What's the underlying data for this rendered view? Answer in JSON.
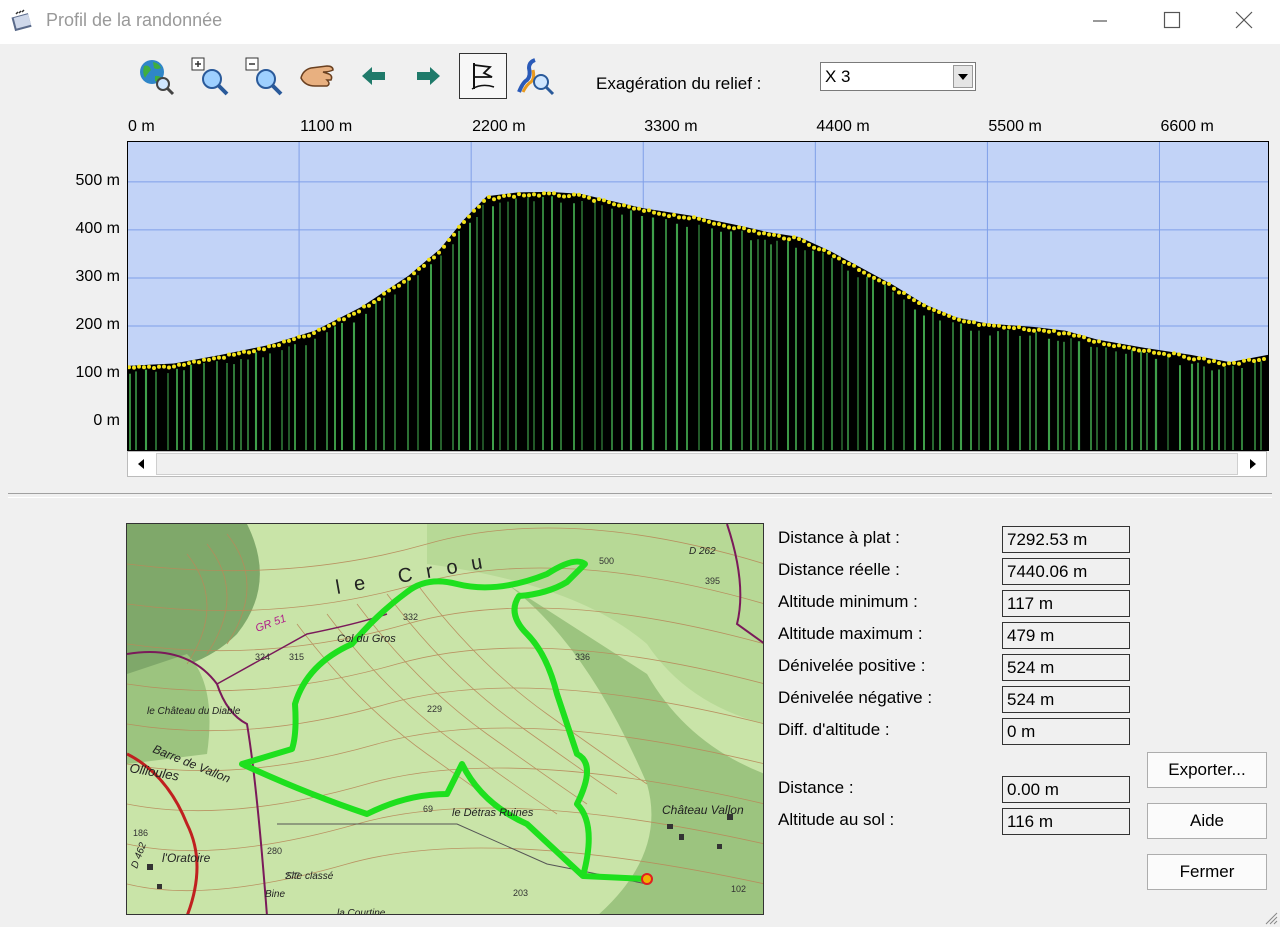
{
  "window": {
    "title": "Profil de la randonnée"
  },
  "toolbar": {
    "buttons": [
      {
        "name": "globe-search-icon"
      },
      {
        "name": "zoom-in-icon"
      },
      {
        "name": "zoom-out-icon"
      },
      {
        "name": "hand-pan-icon"
      },
      {
        "name": "arrow-left-icon"
      },
      {
        "name": "arrow-right-icon"
      },
      {
        "name": "flag-icon",
        "active": true
      },
      {
        "name": "route-search-icon"
      }
    ],
    "exaggeration_label": "Exagération du relief :",
    "exaggeration_value": "X 3"
  },
  "chart_data": {
    "type": "area",
    "x_ticks": [
      "0 m",
      "1100 m",
      "2200 m",
      "3300 m",
      "4400 m",
      "5500 m",
      "6600 m"
    ],
    "y_ticks": [
      "500 m",
      "400 m",
      "300 m",
      "200 m",
      "100 m",
      "0 m"
    ],
    "xlim": [
      0,
      7300
    ],
    "ylim": [
      -60,
      585
    ],
    "grid": true,
    "colors": {
      "sky": "#c2d3f7",
      "grid": "#7f9fe8",
      "terrain": "#000000",
      "stripes": "#3fa04a",
      "markers": "#f2e21a"
    },
    "points": [
      {
        "x": 0,
        "y": 117
      },
      {
        "x": 300,
        "y": 122
      },
      {
        "x": 600,
        "y": 140
      },
      {
        "x": 900,
        "y": 160
      },
      {
        "x": 1200,
        "y": 190
      },
      {
        "x": 1500,
        "y": 240
      },
      {
        "x": 1800,
        "y": 305
      },
      {
        "x": 2000,
        "y": 360
      },
      {
        "x": 2150,
        "y": 420
      },
      {
        "x": 2300,
        "y": 470
      },
      {
        "x": 2500,
        "y": 478
      },
      {
        "x": 2700,
        "y": 479
      },
      {
        "x": 2900,
        "y": 475
      },
      {
        "x": 3100,
        "y": 460
      },
      {
        "x": 3300,
        "y": 445
      },
      {
        "x": 3600,
        "y": 430
      },
      {
        "x": 3900,
        "y": 410
      },
      {
        "x": 4100,
        "y": 395
      },
      {
        "x": 4300,
        "y": 385
      },
      {
        "x": 4500,
        "y": 355
      },
      {
        "x": 4700,
        "y": 320
      },
      {
        "x": 4900,
        "y": 285
      },
      {
        "x": 5100,
        "y": 245
      },
      {
        "x": 5300,
        "y": 218
      },
      {
        "x": 5500,
        "y": 205
      },
      {
        "x": 5800,
        "y": 198
      },
      {
        "x": 6000,
        "y": 190
      },
      {
        "x": 6200,
        "y": 172
      },
      {
        "x": 6500,
        "y": 155
      },
      {
        "x": 6800,
        "y": 140
      },
      {
        "x": 7050,
        "y": 125
      },
      {
        "x": 7292,
        "y": 140
      }
    ]
  },
  "stats": [
    {
      "label": "Distance à plat :",
      "value": "7292.53 m"
    },
    {
      "label": "Distance réelle :",
      "value": "7440.06 m"
    },
    {
      "label": "Altitude minimum :",
      "value": "117 m"
    },
    {
      "label": "Altitude maximum :",
      "value": "479 m"
    },
    {
      "label": "Dénivelée positive :",
      "value": "524 m"
    },
    {
      "label": "Dénivelée négative :",
      "value": "524 m"
    },
    {
      "label": "Diff. d'altitude :",
      "value": "0 m"
    },
    {
      "label": "Distance :",
      "value": "0.00 m"
    },
    {
      "label": "Altitude au sol :",
      "value": "116 m"
    }
  ],
  "buttons": {
    "export": "Exporter...",
    "help": "Aide",
    "close": "Fermer"
  },
  "map": {
    "labels": [
      "le Crou",
      "GR 51",
      "Col du Gros",
      "le Château du Diable",
      "Barre de Vallon",
      "Ollioules",
      "Château Vallon",
      "le Détras Ruines",
      "l'Oratoire",
      "Site classé",
      "la Courtine",
      "Bine",
      "D 262",
      "D 462"
    ],
    "spot_heights": [
      "500",
      "395",
      "324",
      "315",
      "332",
      "336",
      "229",
      "69",
      "280",
      "277",
      "203",
      "102",
      "186"
    ],
    "colors": {
      "track": "#1ee01e",
      "base": "#c7e2a8",
      "contour": "#b88a5a",
      "road": "#7a1a5a"
    }
  }
}
